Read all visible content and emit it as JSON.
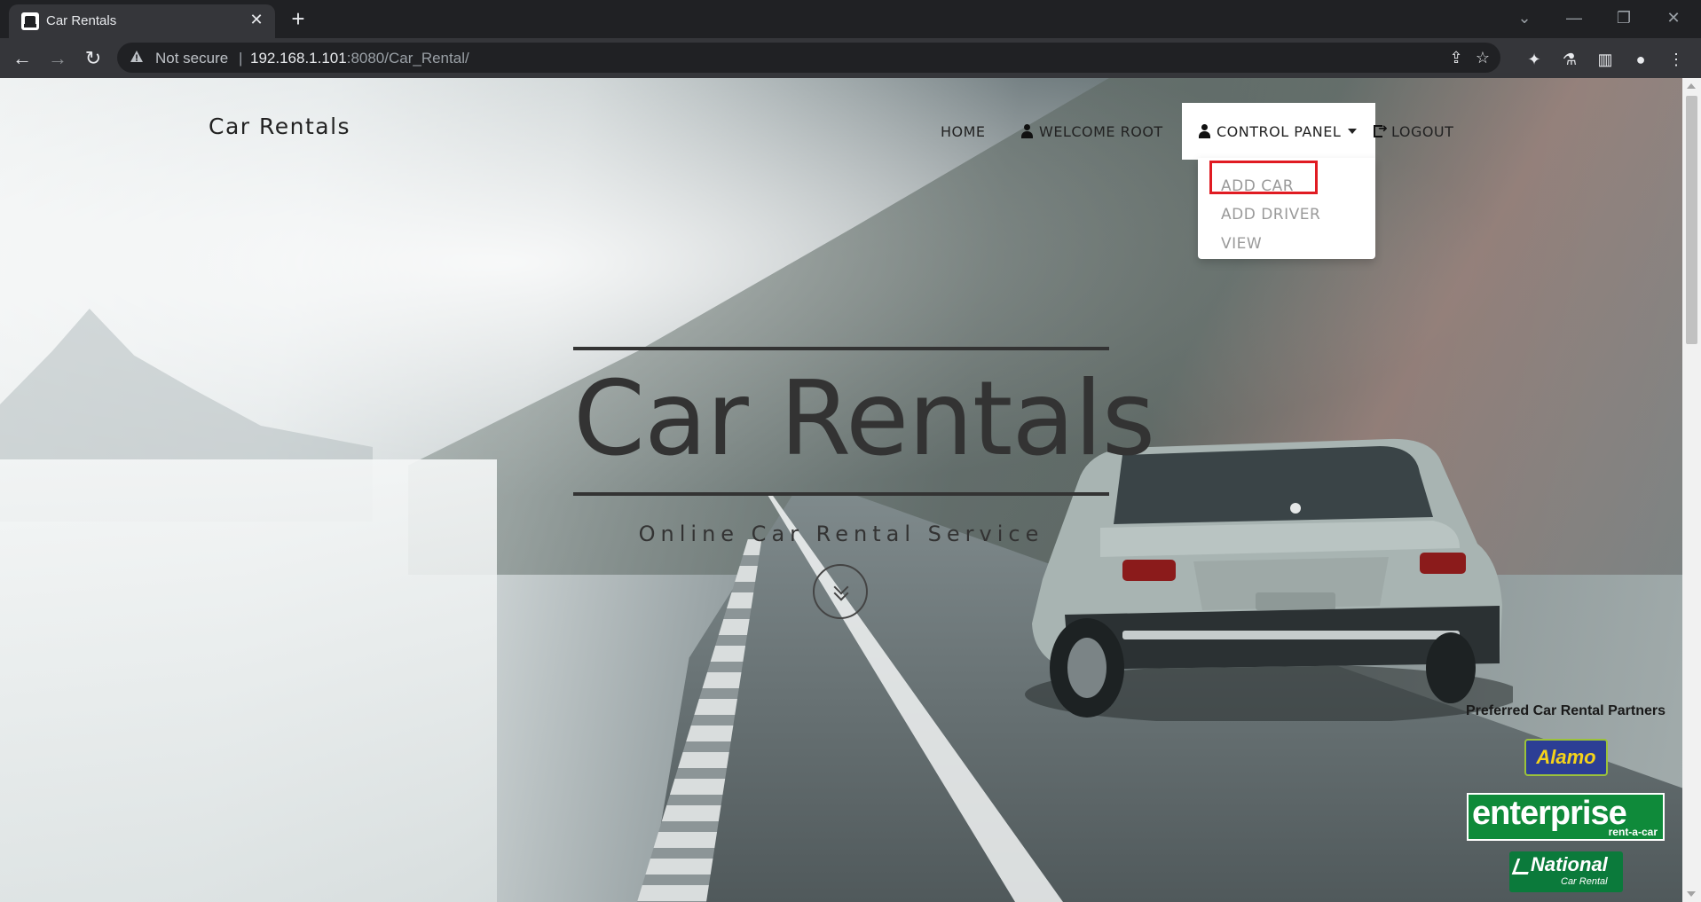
{
  "browser": {
    "tab_title": "Car Rentals",
    "new_tab_label": "+",
    "security_label": "Not secure",
    "url_host": "192.168.1.101",
    "url_rest": ":8080/Car_Rental/"
  },
  "nav": {
    "brand": "Car Rentals",
    "home": "HOME",
    "welcome": "WELCOME ROOT",
    "control_panel": "CONTROL PANEL",
    "logout": "LOGOUT"
  },
  "dropdown": {
    "items": [
      "ADD CAR",
      "ADD DRIVER",
      "VIEW"
    ]
  },
  "hero": {
    "title": "Car Rentals",
    "subtitle": "Online Car Rental Service"
  },
  "partners": {
    "title": "Preferred Car Rental Partners",
    "alamo": "Alamo",
    "enterprise": "enterprise",
    "enterprise_sub": "rent-a-car",
    "national": "National",
    "national_sub": "Car Rental"
  },
  "colors": {
    "highlight": "#e01b22",
    "enterprise_green": "#0f8a3a",
    "alamo_blue": "#2c3e95"
  }
}
